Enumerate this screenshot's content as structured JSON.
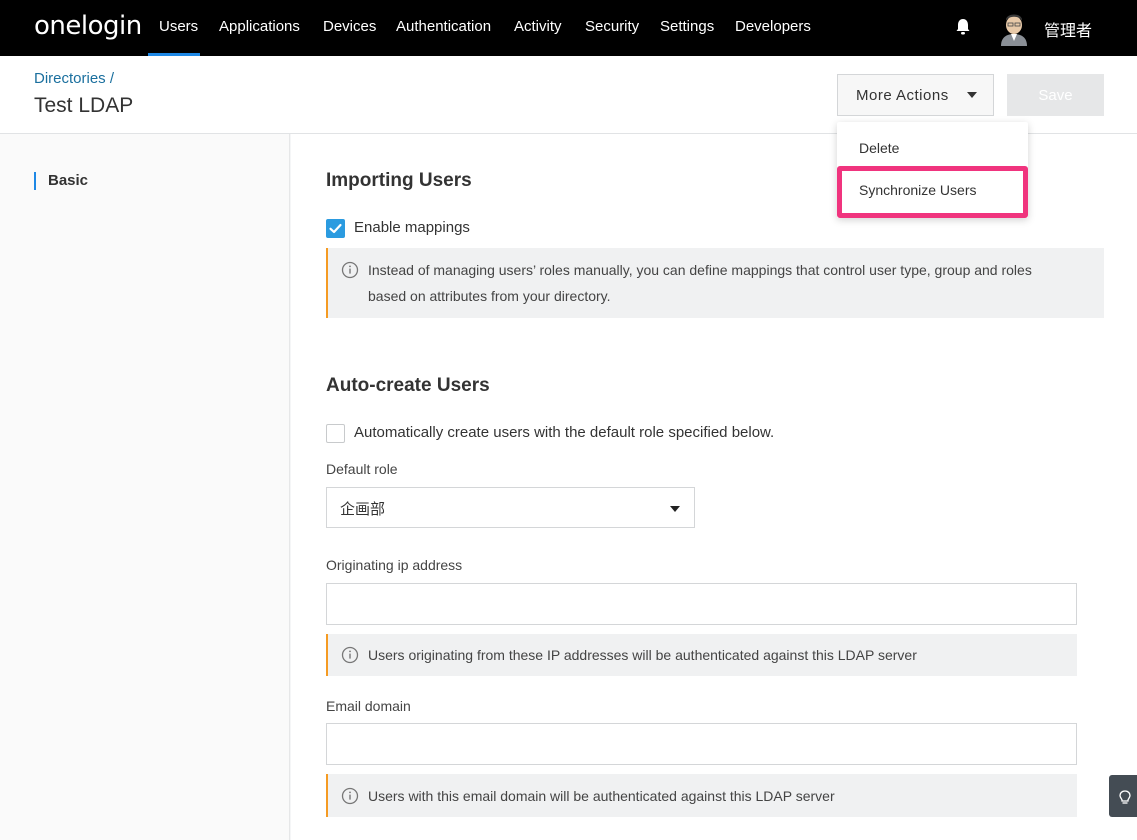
{
  "nav": {
    "logo": "onelogin",
    "items": [
      "Users",
      "Applications",
      "Devices",
      "Authentication",
      "Activity",
      "Security",
      "Settings",
      "Developers"
    ],
    "active_item": "Users",
    "user_name": "管理者",
    "accent_color": "#1e88e5"
  },
  "header": {
    "breadcrumb": "Directories /",
    "title": "Test LDAP",
    "more_actions_label": "More Actions",
    "save_label": "Save"
  },
  "dropdown": {
    "items": [
      "Delete",
      "Synchronize Users"
    ],
    "highlight_color": "#f0347e"
  },
  "sidebar": {
    "items": [
      {
        "label": "Basic"
      }
    ]
  },
  "importing": {
    "title": "Importing Users",
    "enable_mappings_label": "Enable mappings",
    "enable_mappings_checked": true,
    "info_line1": "Instead of managing users’ roles manually, you can define mappings that control user type, group and roles",
    "info_line2": "based on attributes from your directory."
  },
  "autocreate": {
    "title": "Auto-create Users",
    "checkbox_label": "Automatically create users with the default role specified below.",
    "checkbox_checked": false,
    "default_role_label": "Default role",
    "default_role_value": "企画部",
    "ip_label": "Originating ip address",
    "ip_value": "",
    "ip_info": "Users originating from these IP addresses will be authenticated against this LDAP server",
    "email_label": "Email domain",
    "email_value": "",
    "email_info": "Users with this email domain will be authenticated against this LDAP server"
  }
}
